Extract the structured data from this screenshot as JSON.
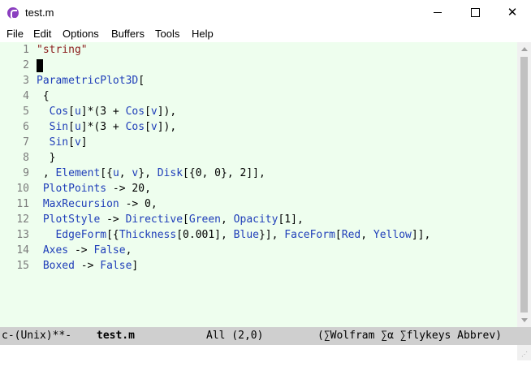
{
  "window": {
    "title": "test.m"
  },
  "menu": [
    "File",
    "Edit",
    "Options",
    "Buffers",
    "Tools",
    "Help"
  ],
  "editor": {
    "lines": [
      {
        "num": "1",
        "segs": [
          {
            "c": "str",
            "t": "\"string\""
          }
        ]
      },
      {
        "num": "2",
        "segs": [],
        "cursor": true
      },
      {
        "num": "3",
        "segs": [
          {
            "c": "kw",
            "t": "ParametricPlot3D"
          },
          {
            "c": "txt",
            "t": "["
          }
        ]
      },
      {
        "num": "4",
        "segs": [
          {
            "c": "txt",
            "t": " {"
          }
        ]
      },
      {
        "num": "5",
        "segs": [
          {
            "c": "txt",
            "t": "  "
          },
          {
            "c": "kw",
            "t": "Cos"
          },
          {
            "c": "txt",
            "t": "["
          },
          {
            "c": "kw",
            "t": "u"
          },
          {
            "c": "txt",
            "t": "]*(3 + "
          },
          {
            "c": "kw",
            "t": "Cos"
          },
          {
            "c": "txt",
            "t": "["
          },
          {
            "c": "kw",
            "t": "v"
          },
          {
            "c": "txt",
            "t": "]),"
          }
        ]
      },
      {
        "num": "6",
        "segs": [
          {
            "c": "txt",
            "t": "  "
          },
          {
            "c": "kw",
            "t": "Sin"
          },
          {
            "c": "txt",
            "t": "["
          },
          {
            "c": "kw",
            "t": "u"
          },
          {
            "c": "txt",
            "t": "]*(3 + "
          },
          {
            "c": "kw",
            "t": "Cos"
          },
          {
            "c": "txt",
            "t": "["
          },
          {
            "c": "kw",
            "t": "v"
          },
          {
            "c": "txt",
            "t": "]),"
          }
        ]
      },
      {
        "num": "7",
        "segs": [
          {
            "c": "txt",
            "t": "  "
          },
          {
            "c": "kw",
            "t": "Sin"
          },
          {
            "c": "txt",
            "t": "["
          },
          {
            "c": "kw",
            "t": "v"
          },
          {
            "c": "txt",
            "t": "]"
          }
        ]
      },
      {
        "num": "8",
        "segs": [
          {
            "c": "txt",
            "t": "  }"
          }
        ]
      },
      {
        "num": "9",
        "segs": [
          {
            "c": "txt",
            "t": " , "
          },
          {
            "c": "kw",
            "t": "Element"
          },
          {
            "c": "txt",
            "t": "[{"
          },
          {
            "c": "kw",
            "t": "u"
          },
          {
            "c": "txt",
            "t": ", "
          },
          {
            "c": "kw",
            "t": "v"
          },
          {
            "c": "txt",
            "t": "}, "
          },
          {
            "c": "kw",
            "t": "Disk"
          },
          {
            "c": "txt",
            "t": "[{0, 0}, 2]],"
          }
        ]
      },
      {
        "num": "10",
        "segs": [
          {
            "c": "txt",
            "t": " "
          },
          {
            "c": "kw",
            "t": "PlotPoints"
          },
          {
            "c": "txt",
            "t": " -> 20,"
          }
        ]
      },
      {
        "num": "11",
        "segs": [
          {
            "c": "txt",
            "t": " "
          },
          {
            "c": "kw",
            "t": "MaxRecursion"
          },
          {
            "c": "txt",
            "t": " -> 0,"
          }
        ]
      },
      {
        "num": "12",
        "segs": [
          {
            "c": "txt",
            "t": " "
          },
          {
            "c": "kw",
            "t": "PlotStyle"
          },
          {
            "c": "txt",
            "t": " -> "
          },
          {
            "c": "kw",
            "t": "Directive"
          },
          {
            "c": "txt",
            "t": "["
          },
          {
            "c": "kw",
            "t": "Green"
          },
          {
            "c": "txt",
            "t": ", "
          },
          {
            "c": "kw",
            "t": "Opacity"
          },
          {
            "c": "txt",
            "t": "[1],"
          }
        ]
      },
      {
        "num": "13",
        "segs": [
          {
            "c": "txt",
            "t": "   "
          },
          {
            "c": "kw",
            "t": "EdgeForm"
          },
          {
            "c": "txt",
            "t": "[{"
          },
          {
            "c": "kw",
            "t": "Thickness"
          },
          {
            "c": "txt",
            "t": "[0.001], "
          },
          {
            "c": "kw",
            "t": "Blue"
          },
          {
            "c": "txt",
            "t": "}], "
          },
          {
            "c": "kw",
            "t": "FaceForm"
          },
          {
            "c": "txt",
            "t": "["
          },
          {
            "c": "kw",
            "t": "Red"
          },
          {
            "c": "txt",
            "t": ", "
          },
          {
            "c": "kw",
            "t": "Yellow"
          },
          {
            "c": "txt",
            "t": "]],"
          }
        ]
      },
      {
        "num": "14",
        "segs": [
          {
            "c": "txt",
            "t": " "
          },
          {
            "c": "kw",
            "t": "Axes"
          },
          {
            "c": "txt",
            "t": " -> "
          },
          {
            "c": "kw",
            "t": "False"
          },
          {
            "c": "txt",
            "t": ","
          }
        ]
      },
      {
        "num": "15",
        "segs": [
          {
            "c": "txt",
            "t": " "
          },
          {
            "c": "kw",
            "t": "Boxed"
          },
          {
            "c": "txt",
            "t": " -> "
          },
          {
            "c": "kw",
            "t": "False"
          },
          {
            "c": "txt",
            "t": "]"
          }
        ]
      }
    ]
  },
  "modeline": {
    "status": "c-(Unix)**-",
    "buffer": "test.m",
    "position": "All (2,0)",
    "modes": "(∑Wolfram ∑α ∑flykeys Abbrev)"
  },
  "colors": {
    "keyword": "#1f3eb9",
    "string": "#8b1c1c",
    "editor_bg": "#eefeee",
    "modeline_bg": "#cfcfcf"
  },
  "icons": {
    "app": "emacs-icon",
    "minimize": "minimize-icon",
    "maximize": "maximize-icon",
    "close": "close-icon"
  }
}
